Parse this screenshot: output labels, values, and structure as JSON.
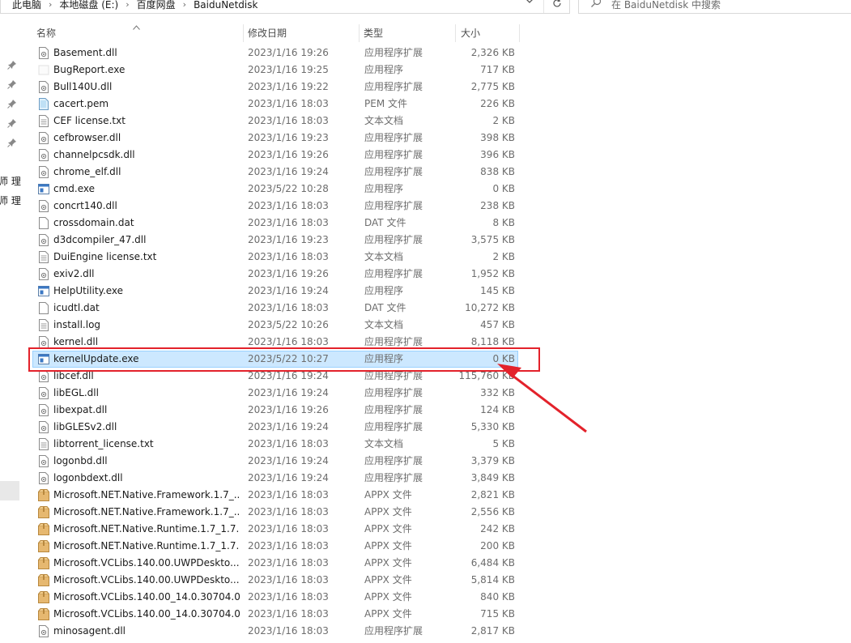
{
  "address_bar": {
    "crumbs": [
      "此电脑",
      "本地磁盘 (E:)",
      "百度网盘",
      "BaiduNetdisk"
    ],
    "dropdown_icon": "chevron-down-icon",
    "refresh_icon": "refresh-icon"
  },
  "search": {
    "placeholder": "在 BaiduNetdisk 中搜索",
    "icon": "search-icon"
  },
  "nav_pane": {
    "fragments": [
      "师 理",
      "师 理"
    ],
    "pin_icon": "pin-icon"
  },
  "columns": {
    "name": "名称",
    "date": "修改日期",
    "type": "类型",
    "size": "大小",
    "sorted_by": "name"
  },
  "files": [
    {
      "name": "Basement.dll",
      "date": "2023/1/16 19:26",
      "type": "应用程序扩展",
      "size": "2,326 KB",
      "icon": "dll"
    },
    {
      "name": "BugReport.exe",
      "date": "2023/1/16 19:25",
      "type": "应用程序",
      "size": "717 KB",
      "icon": "exe-blank"
    },
    {
      "name": "Bull140U.dll",
      "date": "2023/1/16 19:22",
      "type": "应用程序扩展",
      "size": "2,775 KB",
      "icon": "dll"
    },
    {
      "name": "cacert.pem",
      "date": "2023/1/16 18:03",
      "type": "PEM 文件",
      "size": "226 KB",
      "icon": "cert"
    },
    {
      "name": "CEF license.txt",
      "date": "2023/1/16 18:03",
      "type": "文本文档",
      "size": "2 KB",
      "icon": "txt"
    },
    {
      "name": "cefbrowser.dll",
      "date": "2023/1/16 19:23",
      "type": "应用程序扩展",
      "size": "398 KB",
      "icon": "dll"
    },
    {
      "name": "channelpcsdk.dll",
      "date": "2023/1/16 19:26",
      "type": "应用程序扩展",
      "size": "396 KB",
      "icon": "dll"
    },
    {
      "name": "chrome_elf.dll",
      "date": "2023/1/16 19:24",
      "type": "应用程序扩展",
      "size": "838 KB",
      "icon": "dll"
    },
    {
      "name": "cmd.exe",
      "date": "2023/5/22 10:28",
      "type": "应用程序",
      "size": "0 KB",
      "icon": "exe"
    },
    {
      "name": "concrt140.dll",
      "date": "2023/1/16 18:03",
      "type": "应用程序扩展",
      "size": "238 KB",
      "icon": "dll"
    },
    {
      "name": "crossdomain.dat",
      "date": "2023/1/16 18:03",
      "type": "DAT 文件",
      "size": "8 KB",
      "icon": "file"
    },
    {
      "name": "d3dcompiler_47.dll",
      "date": "2023/1/16 19:23",
      "type": "应用程序扩展",
      "size": "3,575 KB",
      "icon": "dll"
    },
    {
      "name": "DuiEngine license.txt",
      "date": "2023/1/16 18:03",
      "type": "文本文档",
      "size": "2 KB",
      "icon": "txt"
    },
    {
      "name": "exiv2.dll",
      "date": "2023/1/16 19:26",
      "type": "应用程序扩展",
      "size": "1,952 KB",
      "icon": "dll"
    },
    {
      "name": "HelpUtility.exe",
      "date": "2023/1/16 19:24",
      "type": "应用程序",
      "size": "145 KB",
      "icon": "exe"
    },
    {
      "name": "icudtl.dat",
      "date": "2023/1/16 18:03",
      "type": "DAT 文件",
      "size": "10,272 KB",
      "icon": "file"
    },
    {
      "name": "install.log",
      "date": "2023/5/22 10:26",
      "type": "文本文档",
      "size": "457 KB",
      "icon": "txt"
    },
    {
      "name": "kernel.dll",
      "date": "2023/1/16 18:03",
      "type": "应用程序扩展",
      "size": "8,118 KB",
      "icon": "dll"
    },
    {
      "name": "kernelUpdate.exe",
      "date": "2023/5/22 10:27",
      "type": "应用程序",
      "size": "0 KB",
      "icon": "exe",
      "selected": true
    },
    {
      "name": "libcef.dll",
      "date": "2023/1/16 19:24",
      "type": "应用程序扩展",
      "size": "115,760 KB",
      "icon": "dll"
    },
    {
      "name": "libEGL.dll",
      "date": "2023/1/16 19:24",
      "type": "应用程序扩展",
      "size": "332 KB",
      "icon": "dll"
    },
    {
      "name": "libexpat.dll",
      "date": "2023/1/16 19:26",
      "type": "应用程序扩展",
      "size": "124 KB",
      "icon": "dll"
    },
    {
      "name": "libGLESv2.dll",
      "date": "2023/1/16 19:24",
      "type": "应用程序扩展",
      "size": "5,330 KB",
      "icon": "dll"
    },
    {
      "name": "libtorrent_license.txt",
      "date": "2023/1/16 18:03",
      "type": "文本文档",
      "size": "5 KB",
      "icon": "txt"
    },
    {
      "name": "logonbd.dll",
      "date": "2023/1/16 19:24",
      "type": "应用程序扩展",
      "size": "3,379 KB",
      "icon": "dll"
    },
    {
      "name": "logonbdext.dll",
      "date": "2023/1/16 19:24",
      "type": "应用程序扩展",
      "size": "3,849 KB",
      "icon": "dll"
    },
    {
      "name": "Microsoft.NET.Native.Framework.1.7_...",
      "date": "2023/1/16 18:03",
      "type": "APPX 文件",
      "size": "2,821 KB",
      "icon": "appx"
    },
    {
      "name": "Microsoft.NET.Native.Framework.1.7_...",
      "date": "2023/1/16 18:03",
      "type": "APPX 文件",
      "size": "2,556 KB",
      "icon": "appx"
    },
    {
      "name": "Microsoft.NET.Native.Runtime.1.7_1.7...",
      "date": "2023/1/16 18:03",
      "type": "APPX 文件",
      "size": "242 KB",
      "icon": "appx"
    },
    {
      "name": "Microsoft.NET.Native.Runtime.1.7_1.7...",
      "date": "2023/1/16 18:03",
      "type": "APPX 文件",
      "size": "200 KB",
      "icon": "appx"
    },
    {
      "name": "Microsoft.VCLibs.140.00.UWPDeskto...",
      "date": "2023/1/16 18:03",
      "type": "APPX 文件",
      "size": "6,484 KB",
      "icon": "appx"
    },
    {
      "name": "Microsoft.VCLibs.140.00.UWPDeskto...",
      "date": "2023/1/16 18:03",
      "type": "APPX 文件",
      "size": "5,814 KB",
      "icon": "appx"
    },
    {
      "name": "Microsoft.VCLibs.140.00_14.0.30704.0...",
      "date": "2023/1/16 18:03",
      "type": "APPX 文件",
      "size": "840 KB",
      "icon": "appx"
    },
    {
      "name": "Microsoft.VCLibs.140.00_14.0.30704.0...",
      "date": "2023/1/16 18:03",
      "type": "APPX 文件",
      "size": "715 KB",
      "icon": "appx"
    },
    {
      "name": "minosagent.dll",
      "date": "2023/1/16 18:03",
      "type": "应用程序扩展",
      "size": "2,817 KB",
      "icon": "dll"
    }
  ],
  "annotation": {
    "highlight_color": "#e3222b",
    "arrow_color": "#e3222b",
    "highlighted_file": "kernelUpdate.exe"
  },
  "colors": {
    "selection_bg": "#cce8ff",
    "selection_border": "#99d1ff",
    "secondary_text": "#6d6d6d"
  }
}
